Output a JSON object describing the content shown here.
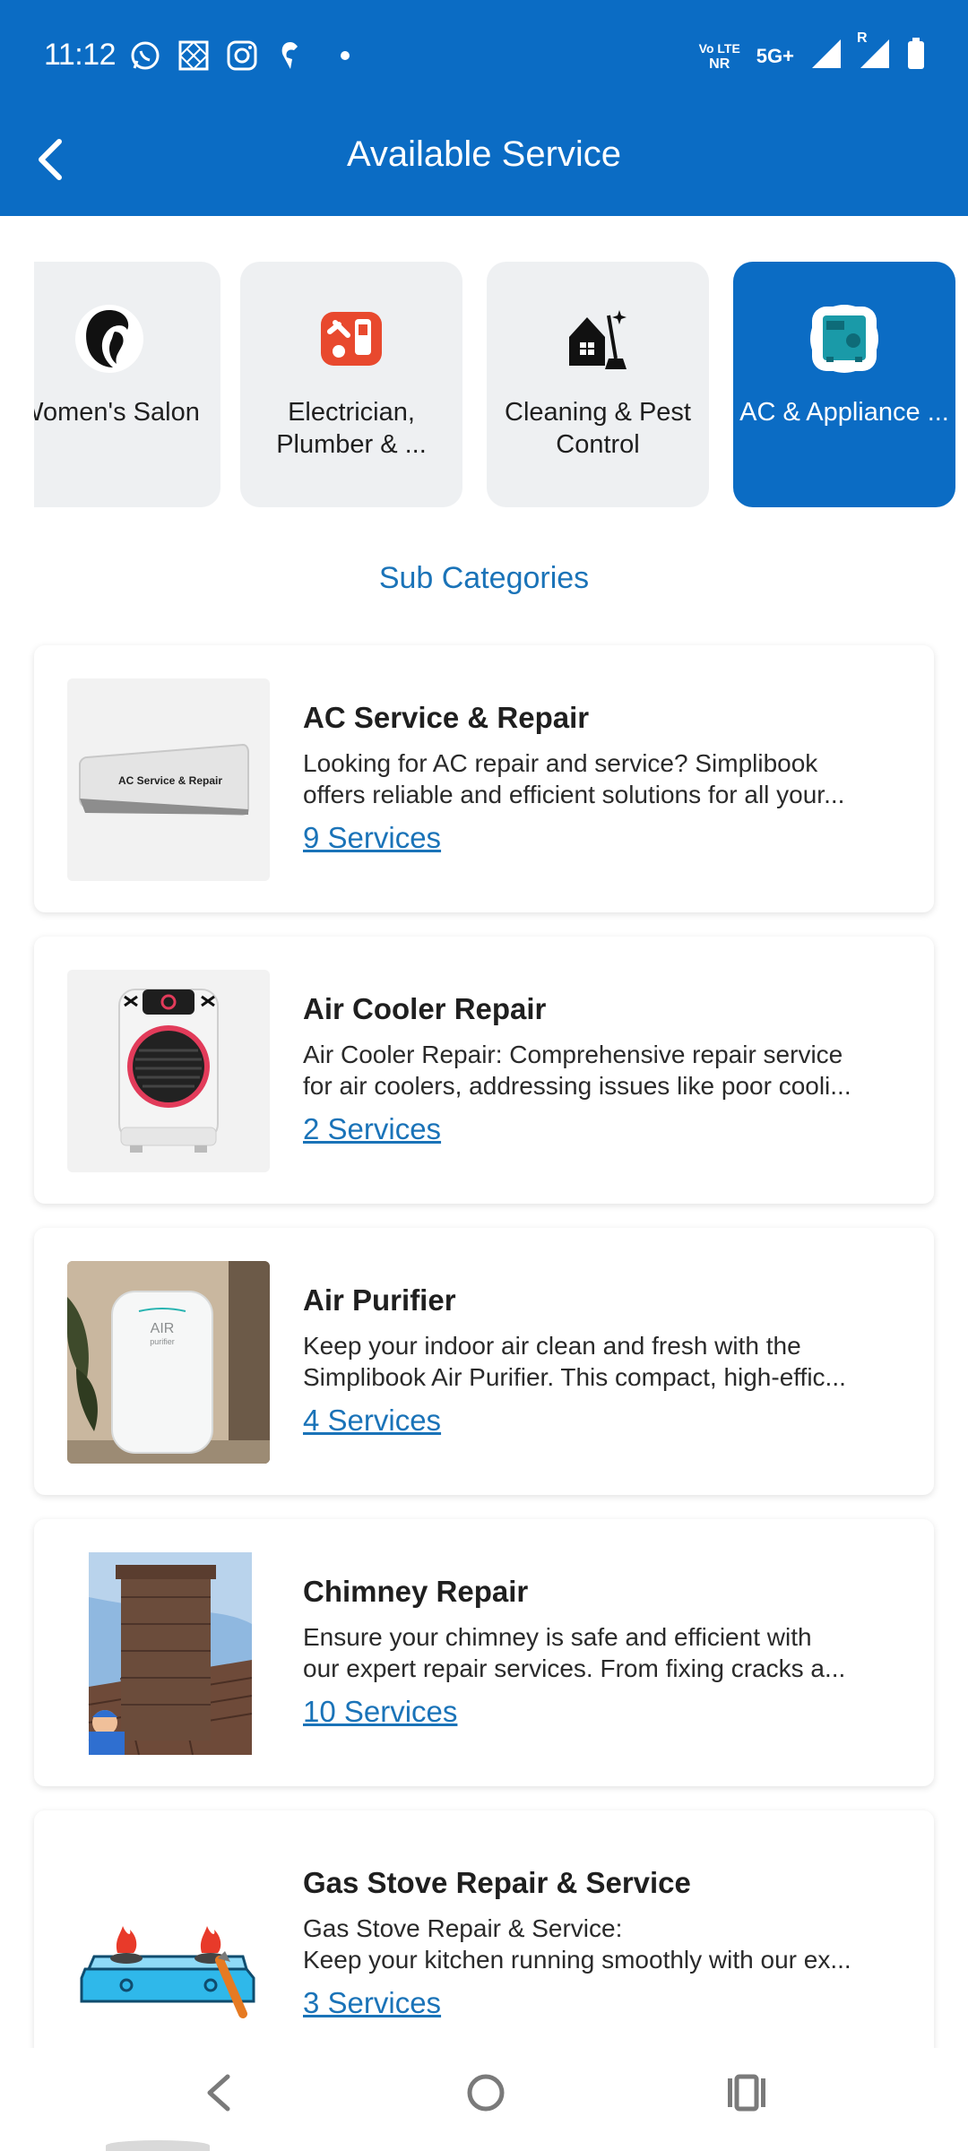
{
  "status_bar": {
    "time": "11:12",
    "network_label_top": "Vo LTE",
    "network_label_bottom": "NR",
    "network_type": "5G+",
    "roaming": "R"
  },
  "header": {
    "title": "Available Service",
    "back_icon": "chevron-left-icon"
  },
  "categories": [
    {
      "label": "Women's Salon",
      "icon": "woman-silhouette-icon",
      "active": false
    },
    {
      "label": "Electrician, Plumber & ...",
      "icon": "tools-icon",
      "active": false
    },
    {
      "label": "Cleaning & Pest Control",
      "icon": "cleaning-house-icon",
      "active": false
    },
    {
      "label": "AC & Appliance ...",
      "icon": "appliance-icon",
      "active": true
    }
  ],
  "subcategories_title": "Sub Categories",
  "services": [
    {
      "title": "AC Service & Repair",
      "desc_line1": "Looking for AC repair and service? Simplibook",
      "desc_line2": "offers reliable and efficient solutions for all your...",
      "count_label": "9 Services",
      "image_caption": "AC Service & Repair"
    },
    {
      "title": "Air Cooler Repair",
      "desc_line1": "Air Cooler Repair: Comprehensive repair service",
      "desc_line2": "for air coolers, addressing issues like poor cooli...",
      "count_label": "2 Services"
    },
    {
      "title": "Air Purifier",
      "desc_line1": "Keep your indoor air clean and fresh with the",
      "desc_line2": "Simplibook Air Purifier. This compact, high-effic...",
      "count_label": "4 Services",
      "image_caption_top": "AIR",
      "image_caption_bottom": "purifier"
    },
    {
      "title": "Chimney Repair",
      "desc_line1": "Ensure your chimney is safe and efficient with",
      "desc_line2": "our expert repair services. From fixing cracks a...",
      "count_label": "10 Services"
    },
    {
      "title": "Gas Stove Repair & Service",
      "desc_line1": "Gas Stove Repair & Service:",
      "desc_line2": "Keep your kitchen running smoothly with our ex...",
      "count_label": "3 Services"
    }
  ],
  "colors": {
    "primary": "#0b6cc4",
    "link": "#1a73b8",
    "card_bg_inactive": "#eef0f2"
  }
}
